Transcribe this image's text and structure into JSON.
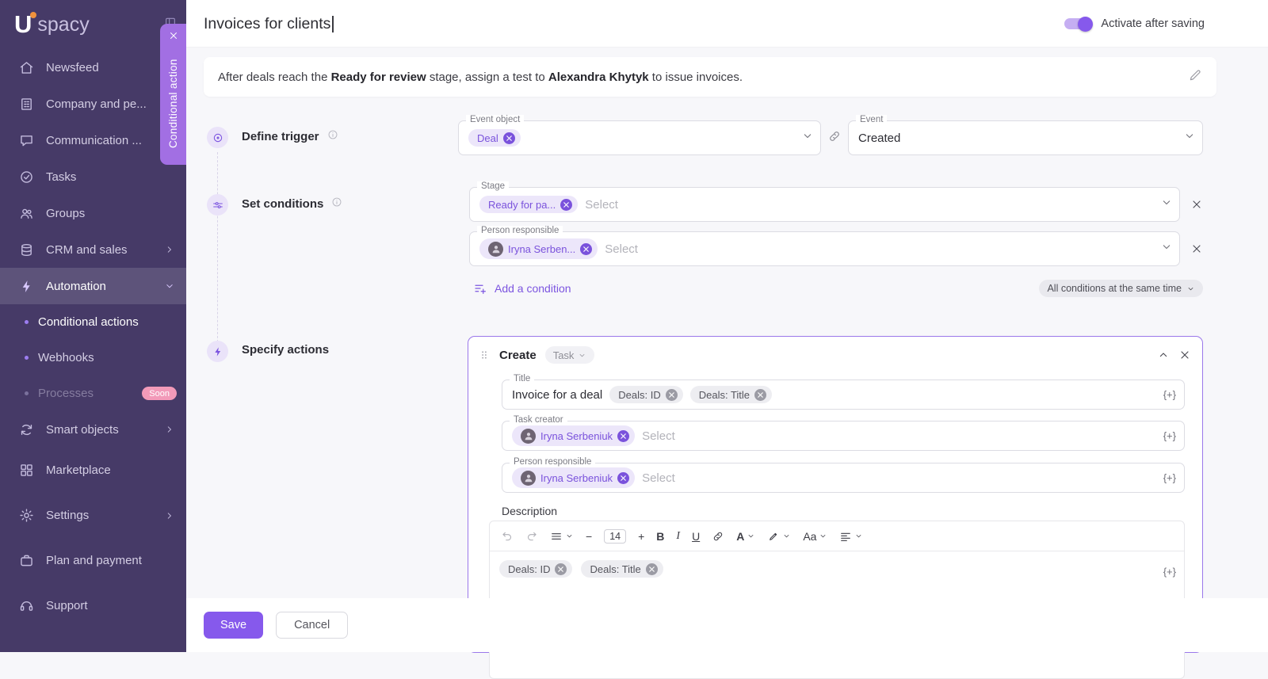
{
  "colors": {
    "accent": "#7A52DC",
    "primary_button": "#8659EC",
    "sidebar_bg": "#463A67",
    "panel_tab_bg": "#A26FE3",
    "soon_badge": "#F29AB9"
  },
  "app": {
    "logo_u": "U",
    "logo_rest": "spacy"
  },
  "sidebar": {
    "items": [
      {
        "label": "Newsfeed"
      },
      {
        "label": "Company and pe..."
      },
      {
        "label": "Communication ..."
      },
      {
        "label": "Tasks"
      },
      {
        "label": "Groups"
      },
      {
        "label": "CRM and sales"
      },
      {
        "label": "Automation"
      },
      {
        "label": "Conditional actions"
      },
      {
        "label": "Webhooks"
      },
      {
        "label": "Processes",
        "badge": "Soon"
      },
      {
        "label": "Smart objects"
      },
      {
        "label": "Marketplace"
      },
      {
        "label": "Settings"
      },
      {
        "label": "Plan and payment"
      },
      {
        "label": "Support"
      }
    ]
  },
  "panel_tab": {
    "label": "Conditional action"
  },
  "header": {
    "name_value": "Invoices for clients",
    "activate_label": "Activate after saving"
  },
  "summary": {
    "part1": "After deals reach the ",
    "stage": "Ready for review",
    "part2": " stage, assign a test to ",
    "person": "Alexandra Khytyk",
    "part3": " to issue invoices."
  },
  "steps": {
    "trigger": "Define trigger",
    "conditions": "Set conditions",
    "actions": "Specify actions"
  },
  "trigger": {
    "event_object_label": "Event object",
    "event_object_chip": "Deal",
    "event_label": "Event",
    "event_value": "Created"
  },
  "conditions": {
    "rows": [
      {
        "label": "Stage",
        "chip": "Ready for pa...",
        "placeholder": "Select"
      },
      {
        "label": "Person responsible",
        "chip": "Iryna Serben...",
        "placeholder": "Select"
      }
    ],
    "add_label": "Add a condition",
    "logic_label": "All conditions at the same time"
  },
  "action": {
    "header_title": "Create",
    "type_label": "Task",
    "insert_token": "{+}",
    "title_field": {
      "label": "Title",
      "value": "Invoice for a deal",
      "chips": [
        "Deals: ID",
        "Deals: Title"
      ]
    },
    "creator_field": {
      "label": "Task creator",
      "chip": "Iryna Serbeniuk",
      "placeholder": "Select"
    },
    "responsible_field": {
      "label": "Person responsible",
      "chip": "Iryna Serbeniuk",
      "placeholder": "Select"
    },
    "description_field": {
      "label": "Description",
      "chips": [
        "Deals: ID",
        "Deals: Title"
      ]
    },
    "toolbar": {
      "font_size": "14",
      "minus": "−",
      "plus": "+",
      "bold": "B",
      "italic": "I",
      "underline": "U",
      "color": "A",
      "case": "Aa"
    }
  },
  "footer": {
    "save_label": "Save",
    "cancel_label": "Cancel"
  }
}
